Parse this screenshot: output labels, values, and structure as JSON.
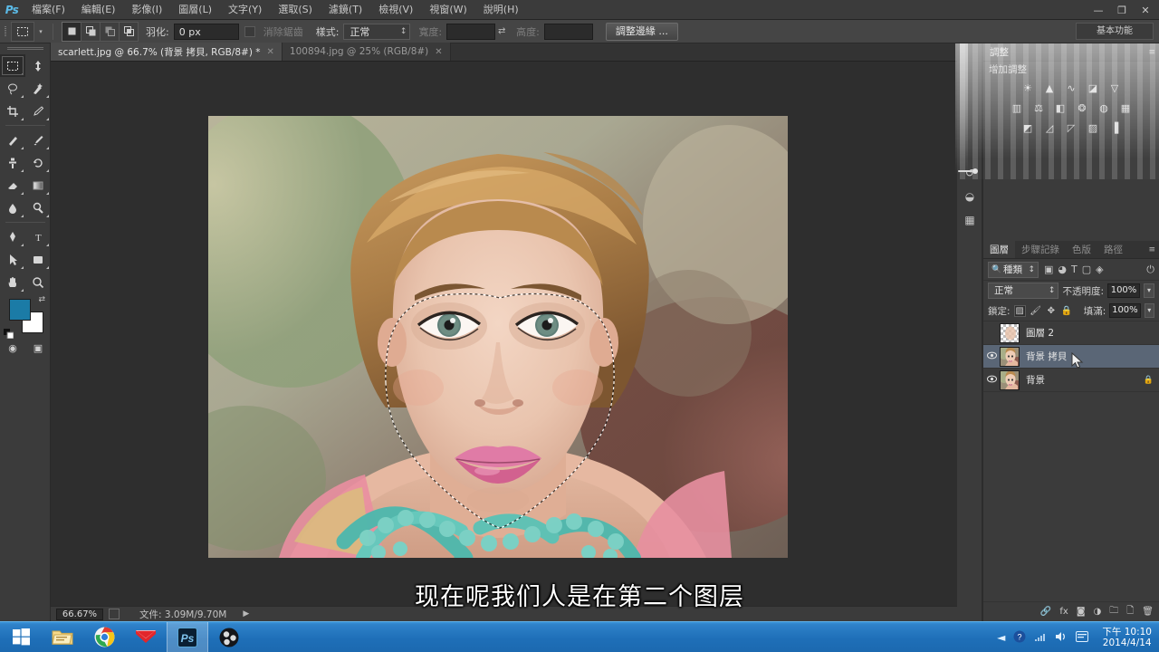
{
  "app": {
    "name": "Ps",
    "logo_text": "Ps"
  },
  "menubar": {
    "items": [
      {
        "label": "檔案(F)"
      },
      {
        "label": "編輯(E)"
      },
      {
        "label": "影像(I)"
      },
      {
        "label": "圖層(L)"
      },
      {
        "label": "文字(Y)"
      },
      {
        "label": "選取(S)"
      },
      {
        "label": "濾鏡(T)"
      },
      {
        "label": "檢視(V)"
      },
      {
        "label": "視窗(W)"
      },
      {
        "label": "說明(H)"
      }
    ],
    "window_buttons": {
      "minimize": "—",
      "maximize": "❐",
      "close": "✕"
    }
  },
  "options_bar": {
    "tool_icon": "rectangular-marquee",
    "feather_label": "羽化:",
    "feather_value": "0 px",
    "antialias_label": "消除鋸齒",
    "style_label": "樣式:",
    "style_value": "正常",
    "width_label": "寬度:",
    "width_value": "",
    "height_label": "高度:",
    "height_value": "",
    "refine_edge_button": "調整邊緣 ...",
    "workspace": "基本功能"
  },
  "toolbar": {
    "tools": [
      {
        "name": "move-tool",
        "glyph": "✥"
      },
      {
        "name": "rectangular-marquee-tool",
        "glyph": "▢"
      },
      {
        "name": "lasso-tool",
        "glyph": "◯"
      },
      {
        "name": "quick-selection-tool",
        "glyph": "✎"
      },
      {
        "name": "crop-tool",
        "glyph": "⌗"
      },
      {
        "name": "eyedropper-tool",
        "glyph": "⌇"
      },
      {
        "name": "spot-healing-brush-tool",
        "glyph": "✚"
      },
      {
        "name": "brush-tool",
        "glyph": "🖌"
      },
      {
        "name": "clone-stamp-tool",
        "glyph": "⎙"
      },
      {
        "name": "history-brush-tool",
        "glyph": "↺"
      },
      {
        "name": "eraser-tool",
        "glyph": "⌫"
      },
      {
        "name": "gradient-tool",
        "glyph": "▤"
      },
      {
        "name": "blur-tool",
        "glyph": "◠"
      },
      {
        "name": "dodge-tool",
        "glyph": "◐"
      },
      {
        "name": "pen-tool",
        "glyph": "✒"
      },
      {
        "name": "type-tool",
        "glyph": "T"
      },
      {
        "name": "path-selection-tool",
        "glyph": "➤"
      },
      {
        "name": "shape-tool",
        "glyph": "▭"
      },
      {
        "name": "hand-tool",
        "glyph": "✋"
      },
      {
        "name": "zoom-tool",
        "glyph": "🔍"
      }
    ],
    "foreground_color": "#1b7ba6",
    "background_color": "#ffffff",
    "quick_mask_glyph": "◉",
    "screen_mode_glyph": "▣"
  },
  "document_tabs": [
    {
      "label": "scarlett.jpg @ 66.7% (背景 拷貝, RGB/8#) *",
      "active": true,
      "close": "✕"
    },
    {
      "label": "100894.jpg @ 25% (RGB/8#)",
      "active": false,
      "close": "✕"
    }
  ],
  "canvas": {
    "selection": "face-marching-ants-selection",
    "image_subject": "portrait-photo"
  },
  "status_bar": {
    "zoom": "66.67%",
    "doc_label": "文件:",
    "doc_size": "3.09M/9.70M",
    "arrow": "▶"
  },
  "dock_rail": {
    "icons": [
      {
        "name": "history-icon",
        "glyph": "↺"
      },
      {
        "name": "color-icon",
        "glyph": "◒"
      },
      {
        "name": "swatches-icon",
        "glyph": "▦"
      }
    ]
  },
  "adjustments_panel": {
    "tab_label": "調整",
    "title": "增加調整",
    "rows": [
      [
        {
          "name": "brightness-contrast-icon",
          "glyph": "☀"
        },
        {
          "name": "levels-icon",
          "glyph": "▲"
        },
        {
          "name": "curves-icon",
          "glyph": "∿"
        },
        {
          "name": "exposure-icon",
          "glyph": "◪"
        },
        {
          "name": "vibrance-icon",
          "glyph": "▽"
        }
      ],
      [
        {
          "name": "hue-saturation-icon",
          "glyph": "▥"
        },
        {
          "name": "color-balance-icon",
          "glyph": "⚖"
        },
        {
          "name": "black-white-icon",
          "glyph": "◧"
        },
        {
          "name": "photo-filter-icon",
          "glyph": "❂"
        },
        {
          "name": "channel-mixer-icon",
          "glyph": "◍"
        },
        {
          "name": "color-lookup-icon",
          "glyph": "▦"
        }
      ],
      [
        {
          "name": "invert-icon",
          "glyph": "◩"
        },
        {
          "name": "posterize-icon",
          "glyph": "◿"
        },
        {
          "name": "threshold-icon",
          "glyph": "◸"
        },
        {
          "name": "gradient-map-icon",
          "glyph": "▨"
        },
        {
          "name": "selective-color-icon",
          "glyph": "▐"
        }
      ]
    ]
  },
  "layers_panel": {
    "tabs": [
      {
        "label": "圖層",
        "active": true
      },
      {
        "label": "步驟記錄",
        "active": false
      },
      {
        "label": "色版",
        "active": false
      },
      {
        "label": "路徑",
        "active": false
      }
    ],
    "menu_glyph": "≡",
    "filter": {
      "kind_label": "種類",
      "icons": [
        {
          "name": "filter-pixel-icon",
          "glyph": "▣"
        },
        {
          "name": "filter-adjustment-icon",
          "glyph": "◕"
        },
        {
          "name": "filter-type-icon",
          "glyph": "T"
        },
        {
          "name": "filter-shape-icon",
          "glyph": "▢"
        },
        {
          "name": "filter-smart-object-icon",
          "glyph": "◈"
        }
      ],
      "toggle_glyph": "⏻"
    },
    "blend_mode": "正常",
    "opacity_label": "不透明度:",
    "opacity_value": "100%",
    "lock_label": "鎖定:",
    "lock_icons": [
      {
        "name": "lock-transparent-pixels-icon",
        "glyph": "▨"
      },
      {
        "name": "lock-image-pixels-icon",
        "glyph": "🖌"
      },
      {
        "name": "lock-position-icon",
        "glyph": "✥"
      },
      {
        "name": "lock-all-icon",
        "glyph": "🔒"
      }
    ],
    "fill_label": "填滿:",
    "fill_value": "100%",
    "layers": [
      {
        "name": "圖層 2",
        "visible": false,
        "selected": false,
        "locked": false,
        "thumb": "checker"
      },
      {
        "name": "背景 拷貝",
        "visible": true,
        "selected": true,
        "locked": false,
        "thumb": "face"
      },
      {
        "name": "背景",
        "visible": true,
        "selected": false,
        "locked": true,
        "thumb": "face",
        "lock_glyph": "🔒"
      }
    ],
    "footer_icons": [
      {
        "name": "link-layers-icon",
        "glyph": "🔗"
      },
      {
        "name": "layer-style-icon",
        "glyph": "fx"
      },
      {
        "name": "layer-mask-icon",
        "glyph": "◙"
      },
      {
        "name": "new-fill-adjustment-icon",
        "glyph": "◑"
      },
      {
        "name": "new-group-icon",
        "glyph": "🗀"
      },
      {
        "name": "new-layer-icon",
        "glyph": "🗋"
      },
      {
        "name": "delete-layer-icon",
        "glyph": "🗑"
      }
    ]
  },
  "subtitle": {
    "text": "现在呢我们人是在第二个图层"
  },
  "taskbar": {
    "start_glyph": "⊞",
    "items": [
      {
        "name": "file-explorer",
        "glyph": "🗂",
        "active": false
      },
      {
        "name": "google-chrome",
        "glyph": "◉",
        "active": false
      },
      {
        "name": "mail-client",
        "glyph": "✉",
        "active": false
      },
      {
        "name": "photoshop",
        "glyph": "Ps",
        "active": true
      },
      {
        "name": "obs-recorder",
        "glyph": "◕",
        "active": false
      }
    ],
    "tray_icons": [
      {
        "name": "show-hidden-icons",
        "glyph": "◄"
      },
      {
        "name": "antivirus-icon",
        "glyph": "◔"
      },
      {
        "name": "network-icon",
        "glyph": "📶"
      },
      {
        "name": "volume-icon",
        "glyph": "🔊"
      },
      {
        "name": "action-center-icon",
        "glyph": "▤"
      }
    ],
    "clock_time": "下午 10:10",
    "clock_date": "2014/4/14"
  },
  "colors": {
    "menubar_bg": "#3b3b3b",
    "panel_bg": "#3b3b3b",
    "canvas_bg": "#2e2e2e",
    "selected_layer": "#5a6676",
    "taskbar_blue": "#1e6fb8"
  }
}
